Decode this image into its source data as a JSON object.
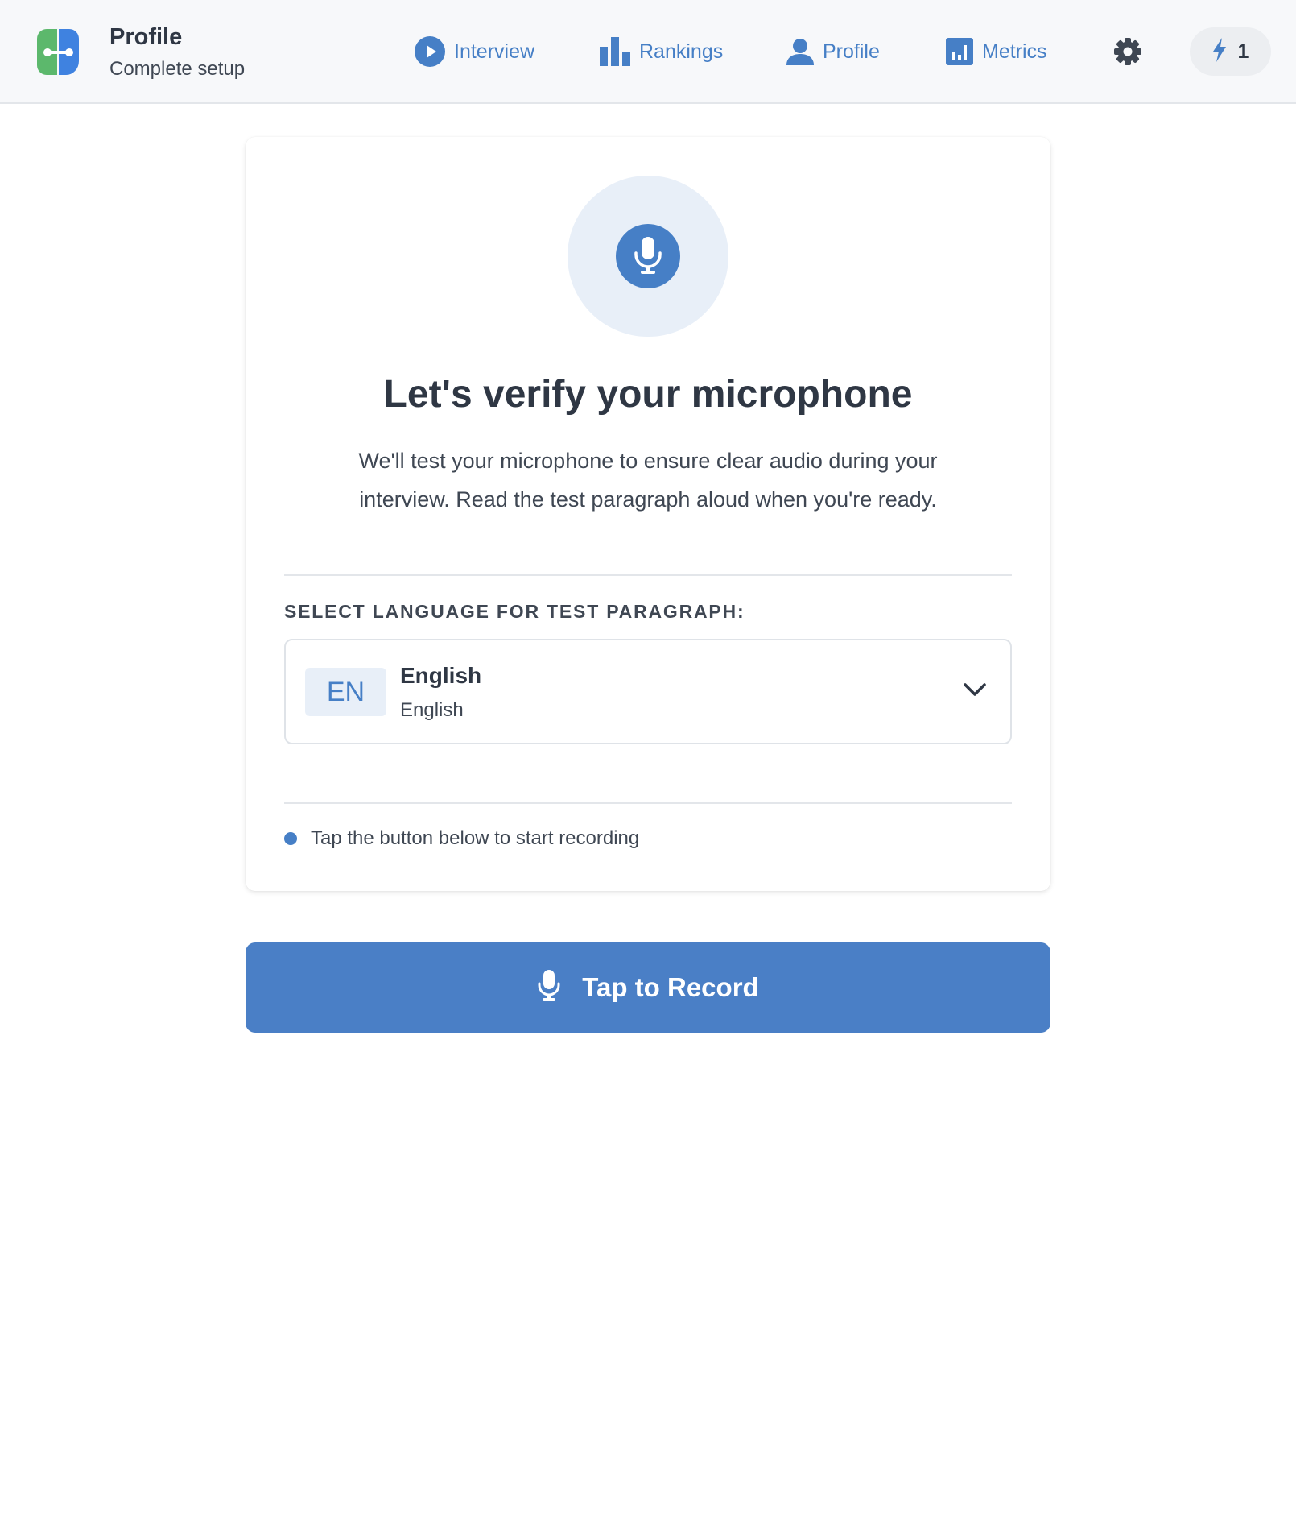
{
  "header": {
    "title": "Profile",
    "subtitle": "Complete setup",
    "nav": [
      {
        "label": "Interview",
        "icon": "play-circle-icon"
      },
      {
        "label": "Rankings",
        "icon": "bar-chart-icon"
      },
      {
        "label": "Profile",
        "icon": "user-icon"
      },
      {
        "label": "Metrics",
        "icon": "metrics-icon"
      }
    ],
    "settings_icon": "gear-icon",
    "credits": {
      "icon": "lightning-icon",
      "count": "1"
    }
  },
  "card": {
    "icon": "microphone-icon",
    "title": "Let's verify your microphone",
    "description": "We'll test your microphone to ensure clear audio during your interview. Read the test paragraph aloud when you're ready.",
    "language_label": "SELECT LANGUAGE FOR TEST PARAGRAPH:",
    "language": {
      "code": "EN",
      "name": "English",
      "native_name": "English"
    },
    "status_text": "Tap the button below to start recording"
  },
  "record_button": {
    "label": "Tap to Record",
    "icon": "microphone-icon"
  },
  "colors": {
    "accent": "#467fc6",
    "accent_light": "#e8eff8",
    "header_bg": "#f7f8fa",
    "text_dark": "#2f3744",
    "logo_green": "#5cb86c",
    "logo_blue": "#3f82e0"
  }
}
